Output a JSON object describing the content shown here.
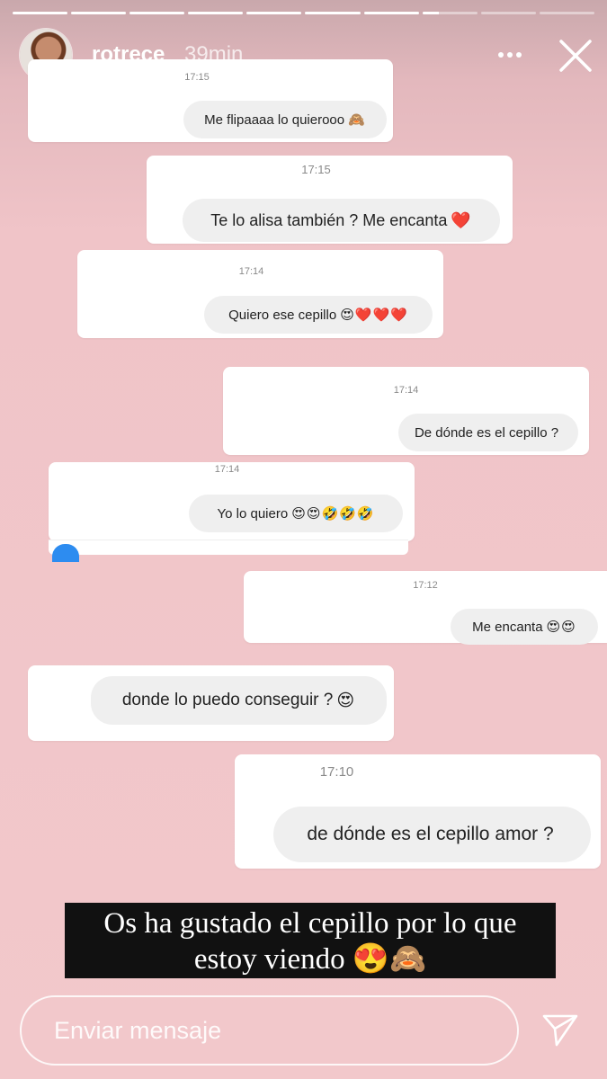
{
  "story": {
    "username": "rotrece",
    "time_ago": "39min",
    "progress_segments": [
      1,
      1,
      1,
      1,
      1,
      1,
      1,
      0.3,
      0,
      0
    ],
    "accent_color": "#ffffff"
  },
  "messages": [
    {
      "timestamp": "17:15",
      "text": "Me flipaaaa lo quierooo",
      "emoji": "🙈"
    },
    {
      "timestamp": "17:15",
      "text": "Te lo alisa también ? Me encanta",
      "emoji": "❤️"
    },
    {
      "timestamp": "17:14",
      "text": "Quiero ese cepillo",
      "emoji": "😍❤️❤️❤️"
    },
    {
      "timestamp": "17:14",
      "text": "De dónde es el cepillo ?",
      "emoji": ""
    },
    {
      "timestamp": "17:14",
      "text": "Yo lo quiero",
      "emoji": "😍😍🤣🤣🤣"
    },
    {
      "timestamp": "17:12",
      "text": "Me encanta",
      "emoji": "😍😍"
    },
    {
      "timestamp": "",
      "text": "donde lo puedo conseguir ?",
      "emoji": "😍"
    },
    {
      "timestamp": "17:10",
      "text": "de dónde es el cepillo amor ?",
      "emoji": ""
    }
  ],
  "caption": {
    "line1": "Os ha gustado  el cepillo por lo que",
    "line2": "estoy viendo",
    "emoji": "😍🙈"
  },
  "reply": {
    "placeholder": "Enviar mensaje"
  },
  "icons": {
    "more": "more-dots-icon",
    "close": "close-icon",
    "send": "send-icon"
  }
}
